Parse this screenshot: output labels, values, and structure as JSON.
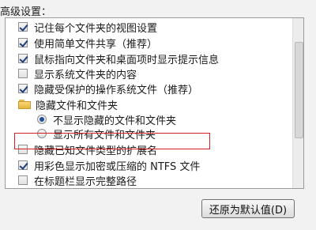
{
  "section_title": "高级设置：",
  "items": [
    {
      "type": "checkbox",
      "checked": true,
      "label": "记住每个文件夹的视图设置"
    },
    {
      "type": "checkbox",
      "checked": true,
      "label": "使用简单文件共享（推荐）"
    },
    {
      "type": "checkbox",
      "checked": true,
      "label": "鼠标指向文件夹和桌面项时显示提示信息"
    },
    {
      "type": "checkbox",
      "checked": false,
      "label": "显示系统文件夹的内容"
    },
    {
      "type": "checkbox",
      "checked": true,
      "label": "隐藏受保护的操作系统文件（推荐）"
    },
    {
      "type": "folder",
      "label": "隐藏文件和文件夹"
    },
    {
      "type": "radio",
      "checked": true,
      "label": "不显示隐藏的文件和文件夹"
    },
    {
      "type": "radio",
      "checked": false,
      "label": "显示所有文件和文件夹"
    },
    {
      "type": "checkbox",
      "checked": false,
      "label": "隐藏已知文件类型的扩展名"
    },
    {
      "type": "checkbox",
      "checked": true,
      "label": "用彩色显示加密或压缩的 NTFS 文件"
    },
    {
      "type": "checkbox",
      "checked": false,
      "label": "在标题栏显示完整路径"
    }
  ],
  "restore_button_label": "还原为默认值(D)",
  "highlight_color": "#d42020",
  "icons": {
    "folder": "folder-icon"
  }
}
